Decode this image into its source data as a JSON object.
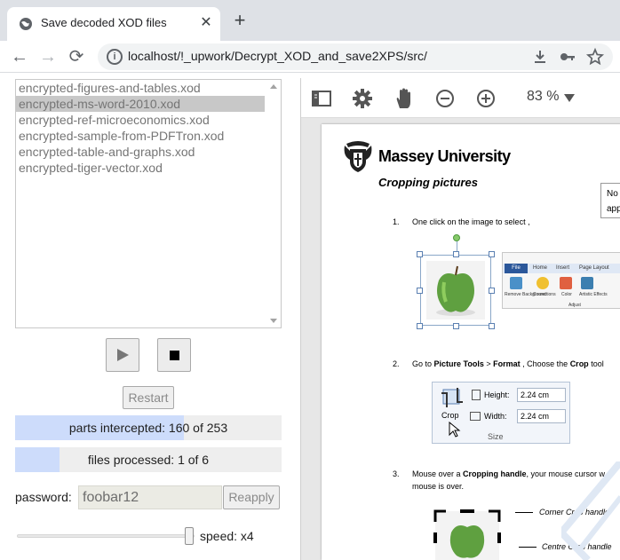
{
  "browser": {
    "tab_title": "Save decoded XOD files",
    "new_tab_symbol": "+",
    "close_symbol": "✕",
    "url": "localhost/!_upwork/Decrypt_XOD_and_save2XPS/src/",
    "nav": {
      "back": "←",
      "forward": "→",
      "reload": "⟳"
    },
    "icons": [
      "download-icon",
      "key-icon",
      "star-icon"
    ]
  },
  "file_list": {
    "items": [
      "encrypted-figures-and-tables.xod",
      "encrypted-ms-word-2010.xod",
      "encrypted-ref-microeconomics.xod",
      "encrypted-sample-from-PDFTron.xod",
      "encrypted-table-and-graphs.xod",
      "encrypted-tiger-vector.xod"
    ],
    "selected_index": 1
  },
  "controls": {
    "restart_label": "Restart"
  },
  "progress": {
    "parts": {
      "text": "parts intercepted: 160 of 253",
      "value": 160,
      "total": 253
    },
    "files": {
      "text": "files processed: 1 of 6",
      "value": 1,
      "total": 6
    }
  },
  "password": {
    "label": "password:",
    "value": "foobar12",
    "reapply_label": "Reapply"
  },
  "speed": {
    "label": "speed: x4",
    "level_fraction": 1.0
  },
  "viewer": {
    "zoom": "83 %",
    "icons": [
      "sidebar-toggle-icon",
      "gear-icon",
      "hand-pan-icon",
      "zoom-out-icon",
      "zoom-in-icon"
    ],
    "page": {
      "university": "Massey University",
      "title": "Cropping pictures",
      "note_line1": "No",
      "note_line2": "app",
      "step1_num": "1.",
      "step1_text": "One click on the image to select ,",
      "step2_num": "2.",
      "step2_pre": "Go to ",
      "step2_b1": "Picture Tools",
      "step2_mid": " > ",
      "step2_b2": "Format",
      "step2_mid2": " , Choose the ",
      "step2_b3": "Crop",
      "step2_post": " tool",
      "step3_num": "3.",
      "step3_pre": "Mouse over a ",
      "step3_b": "Cropping handle",
      "step3_post": ", your mouse cursor w",
      "step3_line2": "mouse is over.",
      "ribbon": {
        "file_tab": "File",
        "tabs": [
          "Home",
          "Insert",
          "Page Layout"
        ],
        "buttons": [
          "Remove Background",
          "Corrections",
          "Color",
          "Artistic Effects"
        ],
        "group": "Adjust"
      },
      "sizebox": {
        "crop_label": "Crop",
        "height_label": "Height:",
        "height_value": "2.24 cm",
        "width_label": "Width:",
        "width_value": "2.24 cm",
        "group": "Size"
      },
      "callouts": {
        "corner": "Corner Crop handle",
        "centre": "Centre Crop handle"
      }
    }
  }
}
